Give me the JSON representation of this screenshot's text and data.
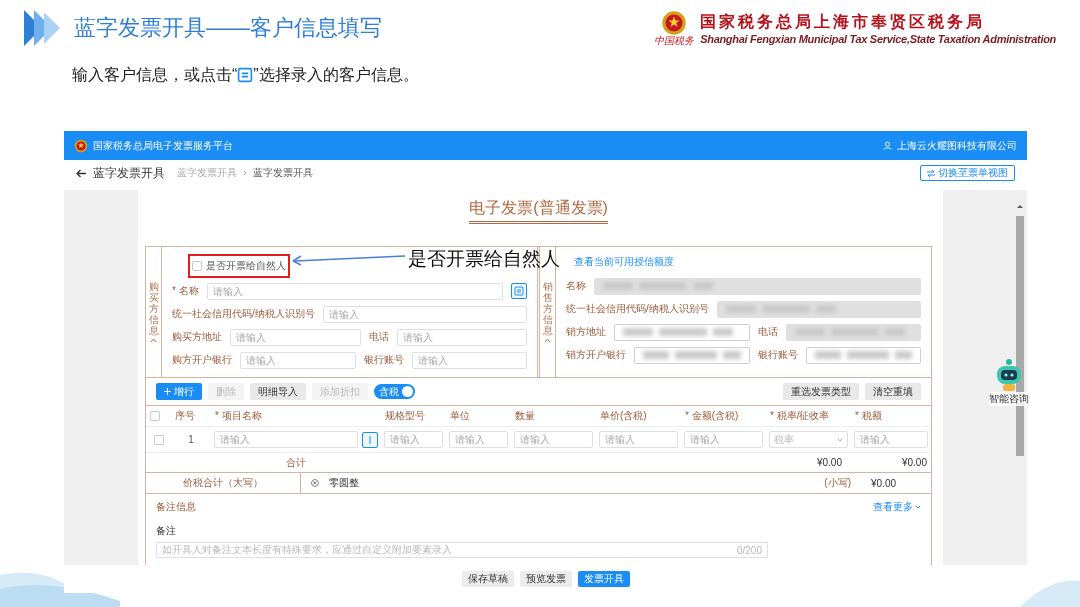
{
  "slide": {
    "title": "蓝字发票开具——客户信息填写",
    "logo_mark": "中国税务",
    "org_name": "国家税务总局上海市奉贤区税务局",
    "org_name_en": "Shanghai Fengxian Municipal Tax Service,State Taxation Administration",
    "instruction_before": "输入客户信息，或点击“",
    "instruction_after": "”选择录入的客户信息。"
  },
  "annotation": {
    "text": "是否开票给自然人"
  },
  "app": {
    "platform_name": "国家税务总局电子发票服务平台",
    "user": "上海云火耀图科技有限公司",
    "page_title": "蓝字发票开具",
    "breadcrumb": [
      "蓝字发票开具",
      "蓝字发票开具"
    ],
    "switch_view_button": "切换至票单视图",
    "invoice_title": "电子发票(普通发票)",
    "buyer": {
      "section_label": "购买方信息",
      "expanded": true,
      "natural_person": {
        "label": "是否开票给自然人",
        "checked": false
      },
      "rows": [
        [
          {
            "label": "* 名称",
            "kind": "picker",
            "placeholder": "请输入",
            "disabled": false
          }
        ],
        [
          {
            "label": "统一社会信用代码/纳税人识别号",
            "kind": "input",
            "placeholder": "请输入",
            "disabled": false
          }
        ],
        [
          {
            "label": "购买方地址",
            "kind": "input",
            "placeholder": "请输入",
            "disabled": false
          },
          {
            "label": "电话",
            "kind": "input",
            "placeholder": "请输入",
            "disabled": false
          }
        ],
        [
          {
            "label": "购方开户银行",
            "kind": "input",
            "placeholder": "请输入",
            "disabled": false
          },
          {
            "label": "银行账号",
            "kind": "input",
            "placeholder": "请输入",
            "disabled": false
          }
        ]
      ]
    },
    "seller": {
      "section_label": "销售方信息",
      "expanded": true,
      "credit_link": "查看当前可用授信额度",
      "rows": [
        [
          {
            "label": "名称",
            "kind": "masked",
            "disabled": true
          }
        ],
        [
          {
            "label": "统一社会信用代码/纳税人识别号",
            "kind": "masked",
            "disabled": true
          }
        ],
        [
          {
            "label": "销方地址",
            "kind": "masked",
            "disabled": false
          },
          {
            "label": "电话",
            "kind": "masked",
            "disabled": true
          }
        ],
        [
          {
            "label": "销方开户银行",
            "kind": "masked",
            "disabled": false
          },
          {
            "label": "银行账号",
            "kind": "masked",
            "disabled": false
          }
        ]
      ]
    },
    "toolbar": {
      "buttons": [
        {
          "label": "增行",
          "kind": "primary",
          "disabled": false
        },
        {
          "label": "删除",
          "kind": "default",
          "disabled": true
        },
        {
          "label": "明细导入",
          "kind": "default",
          "disabled": false
        },
        {
          "label": "添加折扣",
          "kind": "default",
          "disabled": true
        }
      ],
      "tax_toggle": {
        "label": "含税",
        "on": true
      },
      "right_buttons": [
        "重选发票类型",
        "清空重填"
      ]
    },
    "table": {
      "header_checked": false,
      "columns": [
        "序号",
        "* 项目名称",
        "规格型号",
        "单位",
        "数量",
        "单价(含税)",
        "* 金额(含税)",
        "* 税率/征收率",
        "* 税额"
      ],
      "rows": [
        {
          "checked": false,
          "cells": [
            {
              "kind": "text",
              "text": "1"
            },
            {
              "kind": "input",
              "placeholder": "请输入"
            },
            {
              "kind": "input",
              "placeholder": "请输入"
            },
            {
              "kind": "input",
              "placeholder": "请输入"
            },
            {
              "kind": "input",
              "placeholder": "请输入"
            },
            {
              "kind": "input",
              "placeholder": "请输入"
            },
            {
              "kind": "input",
              "placeholder": "请输入"
            },
            {
              "kind": "select",
              "placeholder": "税率"
            },
            {
              "kind": "input",
              "placeholder": "请输入"
            }
          ]
        }
      ],
      "total": {
        "label": "合计",
        "amount": "¥0.00",
        "tax": "¥0.00"
      },
      "grand_total": {
        "label": "价税合计（大写）",
        "uppercase": "零圆整",
        "small_label": "(小写)",
        "value": "¥0.00"
      }
    },
    "remarks": {
      "title": "备注信息",
      "more_link": "查看更多",
      "label": "备注",
      "placeholder": "如开具人对备注文本长度有特殊要求，应通过自定义附加要素录入",
      "counter": "0/200"
    },
    "footer_buttons": [
      {
        "label": "保存草稿",
        "kind": "default"
      },
      {
        "label": "预览发票",
        "kind": "default"
      },
      {
        "label": "发票开具",
        "kind": "primary"
      }
    ],
    "assistant": {
      "label": "智能咨询"
    }
  }
}
